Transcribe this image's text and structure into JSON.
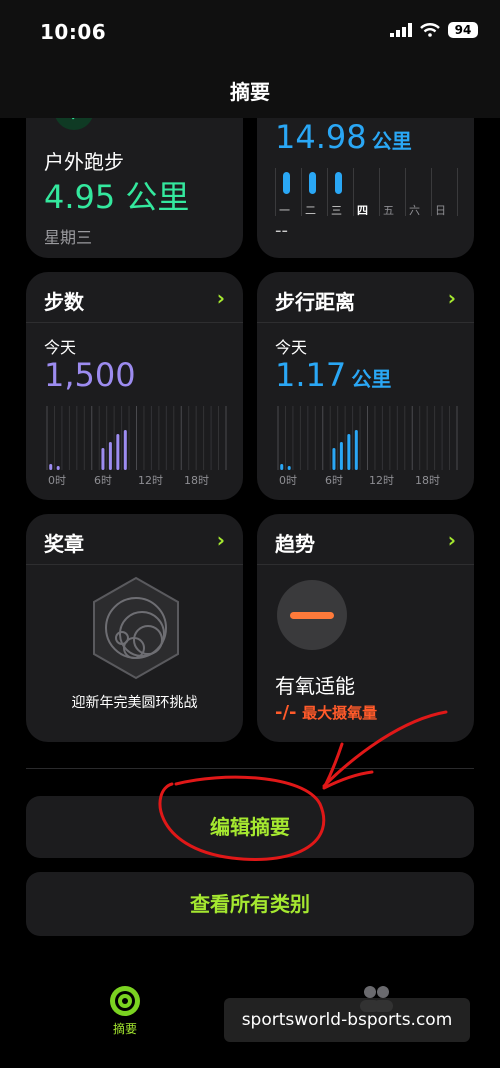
{
  "status": {
    "time": "10:06",
    "battery": "94"
  },
  "nav": {
    "title": "摘要"
  },
  "top_left_card": {
    "title": "户外跑步",
    "distance": "4.95 公里",
    "day": "星期三"
  },
  "top_right_card": {
    "distance_value": "14.98",
    "distance_unit": "公里",
    "weekdays": [
      "一",
      "二",
      "三",
      "四",
      "五",
      "六",
      "日"
    ],
    "placeholder": "--"
  },
  "steps_card": {
    "title": "步数",
    "period": "今天",
    "value": "1,500",
    "ticks": [
      "0时",
      "6时",
      "12时",
      "18时"
    ],
    "accent": "#9d8cf0"
  },
  "distance_card": {
    "title": "步行距离",
    "period": "今天",
    "value": "1.17",
    "unit": "公里",
    "ticks": [
      "0时",
      "6时",
      "12时",
      "18时"
    ],
    "accent": "#2aa7f5"
  },
  "awards_card": {
    "title": "奖章",
    "award_name": "迎新年完美圆环挑战"
  },
  "trends_card": {
    "title": "趋势",
    "metric": "有氧适能",
    "value_dash": "-/-",
    "value_label": "最大摄氧量"
  },
  "buttons": {
    "edit_summary": "编辑摘要",
    "view_all": "查看所有类别"
  },
  "tabbar": {
    "summary_label": "摘要"
  },
  "watermark": "sportsworld-bsports.com",
  "colors": {
    "accent_green": "#a5e830",
    "run_green": "#34e89e",
    "blue": "#2aa7f5",
    "purple": "#9d8cf0",
    "orange": "#ff7a3a",
    "annotation_red": "#e01818"
  }
}
